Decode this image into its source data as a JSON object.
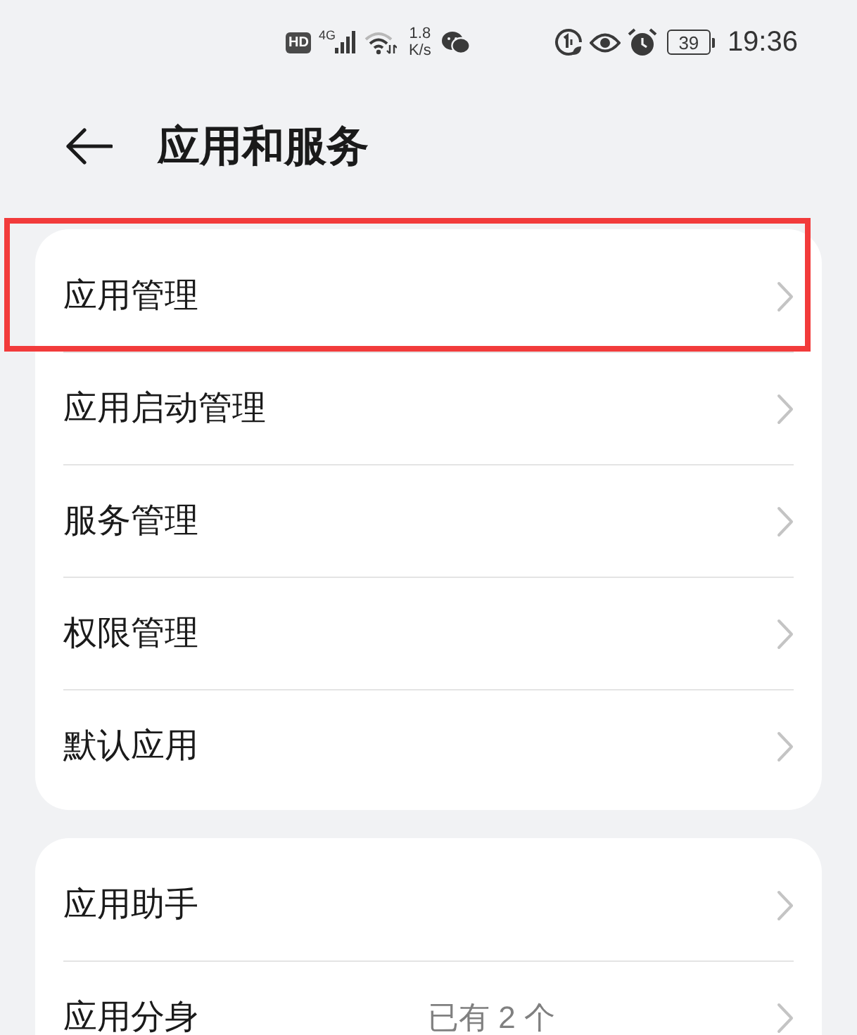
{
  "status_bar": {
    "network_badge": "HD",
    "network_type": "4G",
    "speed_value": "1.8",
    "speed_unit": "K/s",
    "battery": "39",
    "time": "19:36"
  },
  "header": {
    "title": "应用和服务"
  },
  "groups": [
    {
      "items": [
        {
          "label": "应用管理",
          "highlighted": true
        },
        {
          "label": "应用启动管理",
          "highlighted": false
        },
        {
          "label": "服务管理",
          "highlighted": false
        },
        {
          "label": "权限管理",
          "highlighted": false
        },
        {
          "label": "默认应用",
          "highlighted": false
        }
      ]
    },
    {
      "items": [
        {
          "label": "应用助手",
          "highlighted": false
        },
        {
          "label": "应用分身",
          "value": "已有 2 个",
          "highlighted": false
        }
      ]
    }
  ]
}
